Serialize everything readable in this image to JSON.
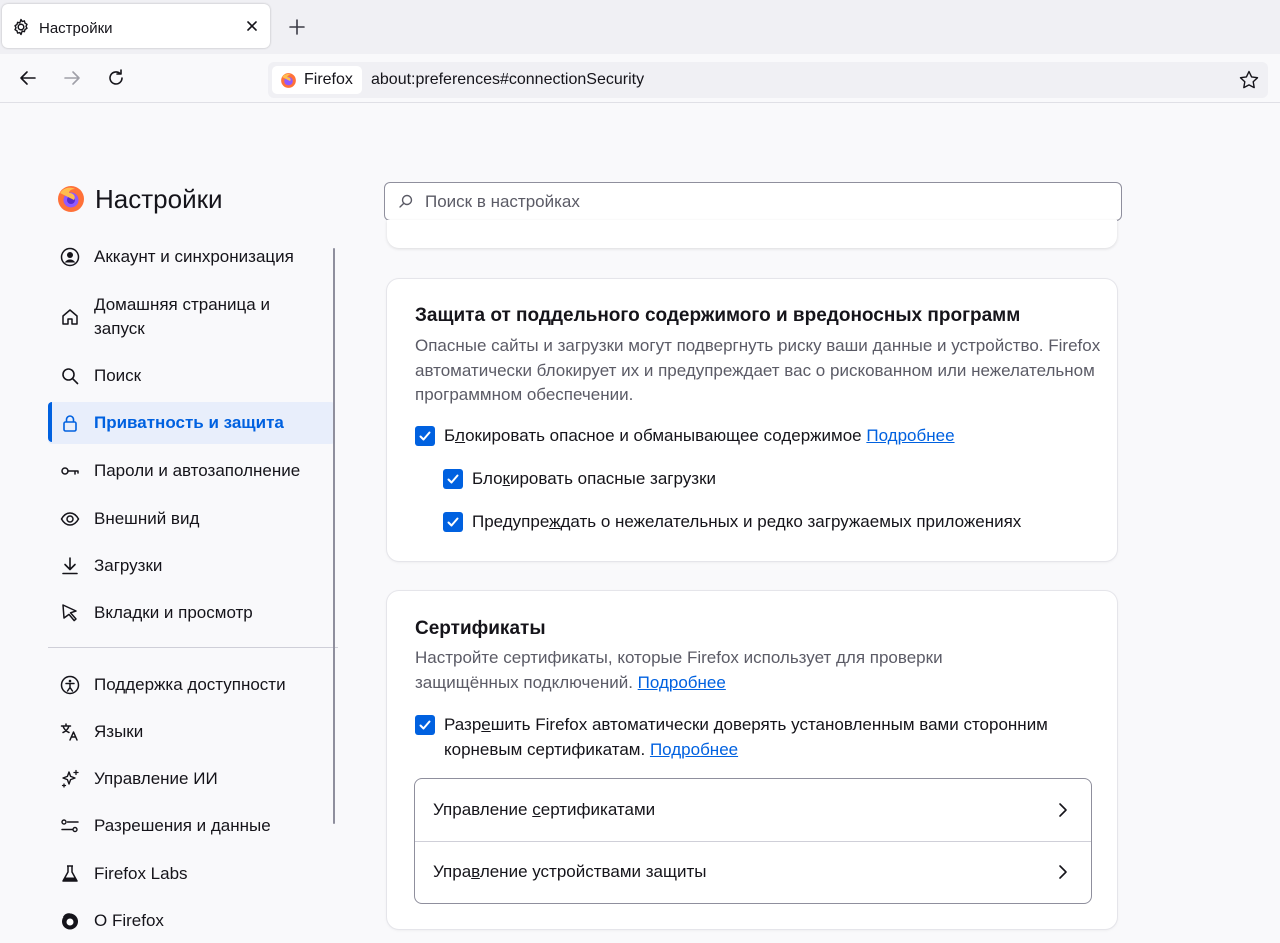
{
  "tab": {
    "title": "Настройки",
    "icon": "gear-icon"
  },
  "urlbar": {
    "identity": "Firefox",
    "url": "about:preferences#connectionSecurity"
  },
  "page": {
    "title": "Настройки"
  },
  "search": {
    "placeholder": "Поиск в настройках"
  },
  "nav": {
    "items": [
      {
        "label": "Аккаунт и синхронизация",
        "icon": "account-icon"
      },
      {
        "label": "Домашняя страница и запуск",
        "icon": "home-icon"
      },
      {
        "label": "Поиск",
        "icon": "search-icon"
      },
      {
        "label": "Приватность и защита",
        "icon": "lock-icon",
        "selected": true
      },
      {
        "label": "Пароли и автозаполнение",
        "icon": "key-icon"
      },
      {
        "label": "Внешний вид",
        "icon": "eye-icon"
      },
      {
        "label": "Загрузки",
        "icon": "download-icon"
      },
      {
        "label": "Вкладки и просмотр",
        "icon": "cursor-icon"
      }
    ],
    "secondary": [
      {
        "label": "Поддержка доступности",
        "icon": "accessibility-icon"
      },
      {
        "label": "Языки",
        "icon": "translate-icon"
      },
      {
        "label": "Управление ИИ",
        "icon": "sparkle-icon"
      },
      {
        "label": "Разрешения и данные",
        "icon": "permissions-icon"
      },
      {
        "label": "Firefox Labs",
        "icon": "flask-icon"
      },
      {
        "label": "О Firefox",
        "icon": "firefox-icon"
      }
    ]
  },
  "deceptive": {
    "title": "Защита от поддельного содержимого и вредоносных программ",
    "description": "Опасные сайты и загрузки могут подвергнуть риску ваши данные и устройство. Firefox автоматически блокирует их и предупреждает вас о рискованном или нежелательном программном обеспечении.",
    "block_dangerous": {
      "pre": "Б",
      "key": "л",
      "post": "окировать опасное и обманывающее содержимое",
      "checked": true
    },
    "learn_more": "Подробнее",
    "block_downloads": {
      "pre": "Бло",
      "key": "к",
      "post": "ировать опасные загрузки",
      "checked": true
    },
    "warn_unwanted": {
      "pre": "Предупре",
      "key": "ж",
      "post": "дать о нежелательных и редко загружаемых приложениях",
      "checked": true
    }
  },
  "certificates": {
    "title": "Сертификаты",
    "description": "Настройте сертификаты, которые Firefox использует для проверки защищённых подключений.",
    "learn_more": "Подробнее",
    "enterprise_roots": {
      "pre": "Разр",
      "key": "е",
      "line1_post": "шить Firefox автоматически доверять установленным вами сторонним",
      "line2": "корневым сертификатам.",
      "checked": true
    },
    "manage_certs": {
      "pre": "Управление ",
      "key": "с",
      "post": "ертификатами"
    },
    "security_devices": {
      "pre": "Упра",
      "key": "в",
      "post": "ление устройствами защиты"
    }
  },
  "colors": {
    "accent": "#0061e0",
    "text": "#15141a",
    "muted": "#5b5b66"
  }
}
